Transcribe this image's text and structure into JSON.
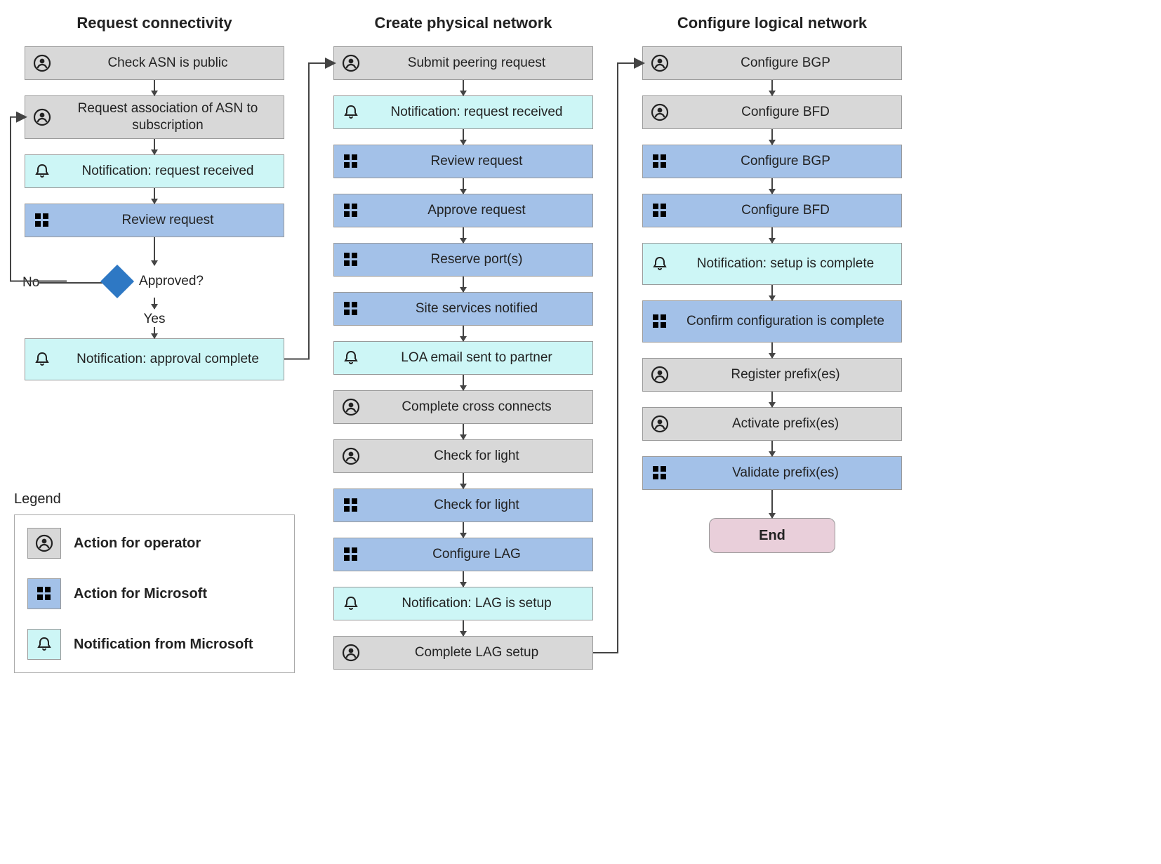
{
  "columns": [
    {
      "title": "Request connectivity"
    },
    {
      "title": "Create physical network"
    },
    {
      "title": "Configure logical network"
    }
  ],
  "decision": {
    "label": "Approved?",
    "yes": "Yes",
    "no": "No"
  },
  "end": "End",
  "col1": {
    "s0": "Check ASN is public",
    "s1": "Request association of ASN to subscription",
    "s2": "Notification: request received",
    "s3": "Review request",
    "s4": "Notification: approval complete"
  },
  "col2": {
    "s0": "Submit peering request",
    "s1": "Notification: request received",
    "s2": "Review request",
    "s3": "Approve request",
    "s4": "Reserve port(s)",
    "s5": "Site services notified",
    "s6": "LOA email sent to partner",
    "s7": "Complete cross connects",
    "s8": "Check for light",
    "s9": "Check for light",
    "s10": "Configure LAG",
    "s11": "Notification: LAG is setup",
    "s12": "Complete LAG setup"
  },
  "col3": {
    "s0": "Configure BGP",
    "s1": "Configure BFD",
    "s2": "Configure BGP",
    "s3": "Configure BFD",
    "s4": "Notification: setup is complete",
    "s5": "Confirm configuration is complete",
    "s6": "Register prefix(es)",
    "s7": "Activate prefix(es)",
    "s8": "Validate prefix(es)"
  },
  "legend": {
    "title": "Legend",
    "operator": "Action for operator",
    "microsoft": "Action for Microsoft",
    "notification": "Notification from Microsoft"
  }
}
